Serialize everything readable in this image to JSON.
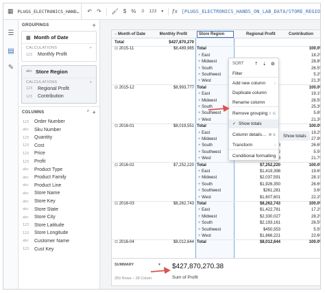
{
  "topbar": {
    "title": "PLUGS_ELECTRONICS_HAND…",
    "number_format": "123",
    "formula": "[PLUGS_ELECTRONICS_HANDS_ON_LAB_DATA/STORE_REGIO"
  },
  "left_panel": {
    "groupings_label": "GROUPINGS",
    "group1": {
      "name": "Month of Date",
      "calc_label": "CALCULATIONS",
      "calcs": [
        {
          "type": "123",
          "name": "Monthly Profit"
        }
      ]
    },
    "group2": {
      "name": "Store Region",
      "type": "abc",
      "calc_label": "CALCULATIONS",
      "calcs": [
        {
          "type": "123",
          "name": "Regional Profit"
        },
        {
          "type": "123",
          "name": "Contribution"
        }
      ]
    },
    "columns_label": "COLUMNS",
    "columns": [
      {
        "type": "123",
        "name": "Order Number"
      },
      {
        "type": "abc",
        "name": "Sku Number"
      },
      {
        "type": "123",
        "name": "Quantity"
      },
      {
        "type": "123",
        "name": "Cost"
      },
      {
        "type": "123",
        "name": "Price"
      },
      {
        "type": "123",
        "name": "Profit"
      },
      {
        "type": "abc",
        "name": "Product Type"
      },
      {
        "type": "abc",
        "name": "Product Family"
      },
      {
        "type": "abc",
        "name": "Product Line"
      },
      {
        "type": "abc",
        "name": "Store Name"
      },
      {
        "type": "abc",
        "name": "Store Key"
      },
      {
        "type": "abc",
        "name": "Store State"
      },
      {
        "type": "abc",
        "name": "Store City"
      },
      {
        "type": "123",
        "name": "Store Latitude"
      },
      {
        "type": "123",
        "name": "Store Longitude"
      },
      {
        "type": "abc",
        "name": "Customer Name"
      },
      {
        "type": "123",
        "name": "Cust Key"
      }
    ]
  },
  "table": {
    "headers": [
      "Month of Date",
      "Monthly Profit",
      "Store Region",
      "Regional Profit",
      "Contribution"
    ],
    "total_label": "Total",
    "grand_total": "$427,870,270",
    "months": [
      {
        "month": "2015-11",
        "profit": "$8,489,985",
        "rows": [
          {
            "region": "Total",
            "rp": "",
            "c": "100.0%"
          },
          {
            "region": "East",
            "rp": "",
            "c": "18.2%"
          },
          {
            "region": "Midwest",
            "rp": "",
            "c": "28.8%"
          },
          {
            "region": "South",
            "rp": "",
            "c": "26.5%"
          },
          {
            "region": "Southwest",
            "rp": "",
            "c": "5.2%"
          },
          {
            "region": "West",
            "rp": "",
            "c": "21.3%"
          }
        ]
      },
      {
        "month": "2015-12",
        "profit": "$8,993,777",
        "rows": [
          {
            "region": "Total",
            "rp": "",
            "c": "100.0%"
          },
          {
            "region": "East",
            "rp": "",
            "c": "19.1%"
          },
          {
            "region": "Midwest",
            "rp": "",
            "c": "28.5%"
          },
          {
            "region": "South",
            "rp": "",
            "c": "25.3%"
          },
          {
            "region": "Southwest",
            "rp": "",
            "c": "5.8%"
          },
          {
            "region": "West",
            "rp": "",
            "c": "21.3%"
          }
        ]
      },
      {
        "month": "2016-01",
        "profit": "$8,019,551",
        "rows": [
          {
            "region": "Total",
            "rp": "",
            "c": "100.0%"
          },
          {
            "region": "East",
            "rp": "",
            "c": "19.2%"
          },
          {
            "region": "Midwest",
            "rp": "",
            "c": "27.9%"
          },
          {
            "region": "South",
            "rp": "$2,135,238",
            "c": "26.6%"
          },
          {
            "region": "Southwest",
            "rp": "$442,452",
            "c": "5.5%"
          },
          {
            "region": "West",
            "rp": "$1,737,573",
            "c": "21.7%"
          }
        ]
      },
      {
        "month": "2016-02",
        "profit": "$7,252,220",
        "rows": [
          {
            "region": "Total",
            "rp": "$7,252,220",
            "c": "100.0%"
          },
          {
            "region": "East",
            "rp": "$1,419,398",
            "c": "19.6%"
          },
          {
            "region": "Midwest",
            "rp": "$2,037,591",
            "c": "28.1%"
          },
          {
            "region": "South",
            "rp": "$1,926,350",
            "c": "26.6%"
          },
          {
            "region": "Southwest",
            "rp": "$261,281",
            "c": "3.6%"
          },
          {
            "region": "West",
            "rp": "$1,607,601",
            "c": "22.2%"
          }
        ]
      },
      {
        "month": "2016-03",
        "profit": "$8,262,743",
        "rows": [
          {
            "region": "Total",
            "rp": "$8,262,743",
            "c": "100.0%"
          },
          {
            "region": "East",
            "rp": "$1,422,781",
            "c": "17.2%"
          },
          {
            "region": "Midwest",
            "rp": "$2,330,027",
            "c": "28.2%"
          },
          {
            "region": "South",
            "rp": "$2,193,161",
            "c": "26.5%"
          },
          {
            "region": "Southwest",
            "rp": "$450,553",
            "c": "5.5%"
          },
          {
            "region": "West",
            "rp": "$1,866,221",
            "c": "22.6%"
          }
        ]
      },
      {
        "month": "2016-04",
        "profit": "$8,012,644",
        "rows": [
          {
            "region": "Total",
            "rp": "$8,012,644",
            "c": "100.0%"
          }
        ]
      }
    ]
  },
  "summary": {
    "label": "SUMMARY",
    "value": "$427,870,270.38",
    "caption": "Sum of Profit",
    "rows_info": "250 Rows – 28 Colum"
  },
  "menu": {
    "title": "SORT",
    "items": [
      {
        "label": "Filter",
        "shortcut": ""
      },
      {
        "label": "Add new column",
        "shortcut": "›"
      },
      {
        "label": "Duplicate column",
        "shortcut": ""
      },
      {
        "label": "Rename column",
        "shortcut": ""
      },
      {
        "label": "Remove grouping",
        "shortcut": "⇧ G"
      },
      {
        "label": "Show totals",
        "shortcut": ""
      },
      {
        "label": "Column details…",
        "shortcut": "⌘ E"
      },
      {
        "label": "Transform",
        "shortcut": "›"
      },
      {
        "label": "Conditional formatting",
        "shortcut": ""
      }
    ],
    "tooltip": "Show totals"
  },
  "colors": {
    "accent": "#3b6fb6",
    "arrow": "#d9534f",
    "selection": "#7aa6d8"
  }
}
